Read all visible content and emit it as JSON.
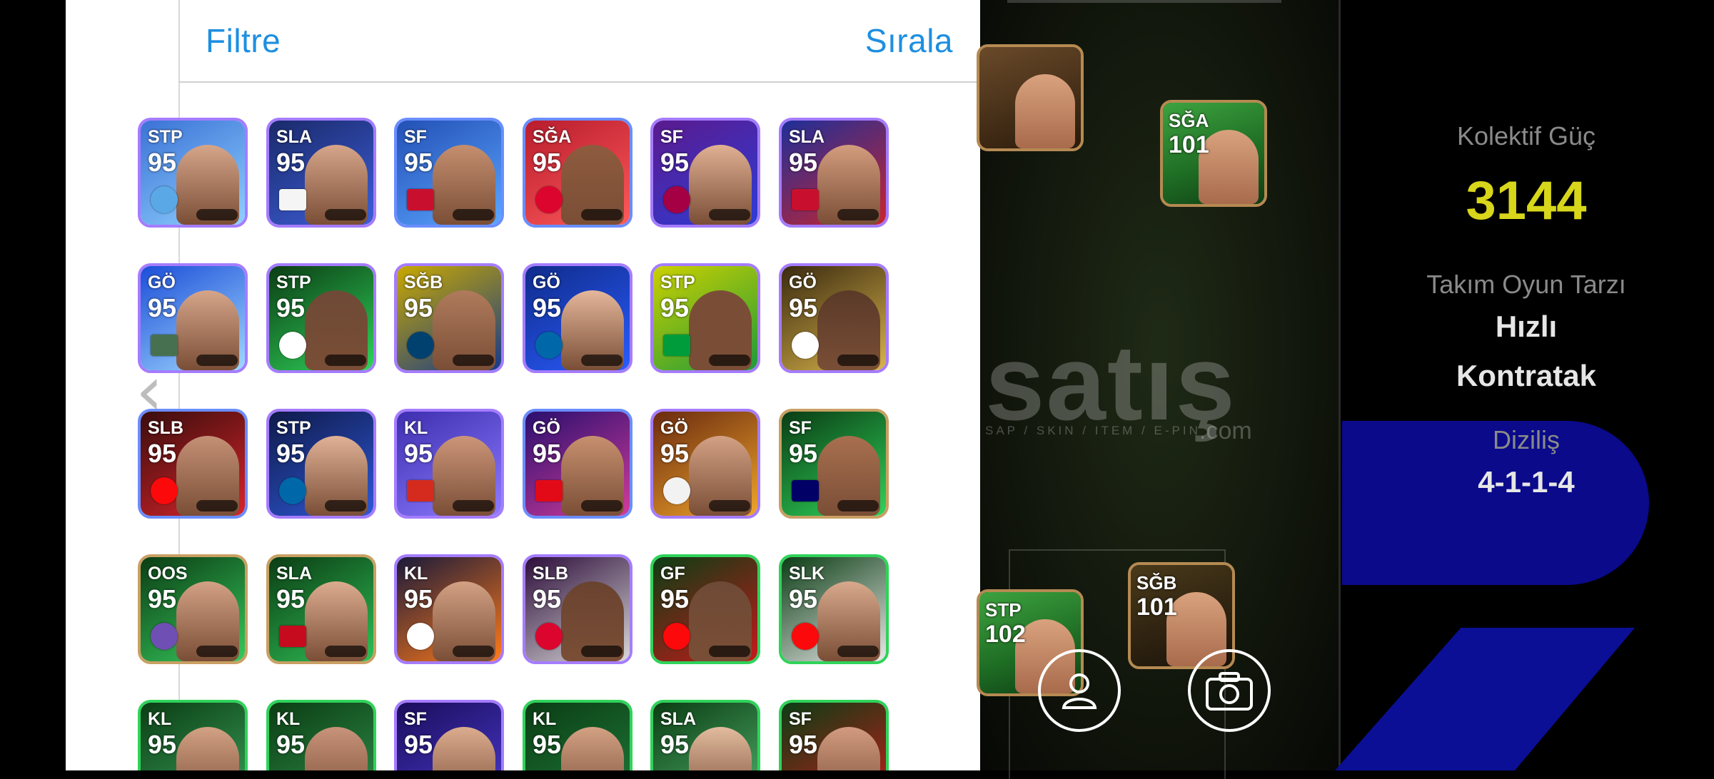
{
  "header": {
    "filter_label": "Filtre",
    "sort_label": "Sırala"
  },
  "cards": [
    {
      "pos": "STP",
      "rating": "95",
      "bg": "#3b72d6",
      "bg2": "#8fd0ff",
      "border": "b-purple",
      "badge": "round",
      "badge_color": "#5aa9e6",
      "face": "#d6a58a"
    },
    {
      "pos": "SLA",
      "rating": "95",
      "bg": "#1a2a6b",
      "bg2": "#3d5ed8",
      "border": "b-purple",
      "badge": "flag",
      "badge_color": "#f5f5f5",
      "face": "#d6a58a"
    },
    {
      "pos": "SF",
      "rating": "95",
      "bg": "#2350b5",
      "bg2": "#5aa5ff",
      "border": "b-blue",
      "badge": "flag",
      "badge_color": "#c8102e",
      "face": "#c58e6f"
    },
    {
      "pos": "SĞA",
      "rating": "95",
      "bg": "#b81c2d",
      "bg2": "#ff5a5a",
      "border": "b-blue",
      "badge": "round",
      "badge_color": "#dc052d",
      "face": "#8e5b3e"
    },
    {
      "pos": "SF",
      "rating": "95",
      "bg": "#5b1a8e",
      "bg2": "#2d3dd6",
      "border": "b-purple",
      "badge": "round",
      "badge_color": "#a50044",
      "face": "#e0b093"
    },
    {
      "pos": "SLA",
      "rating": "95",
      "bg": "#1e2f99",
      "bg2": "#c9242f",
      "border": "b-purple",
      "badge": "flag",
      "badge_color": "#c8102e",
      "face": "#d39c7e"
    },
    {
      "pos": "GÖ",
      "rating": "95",
      "bg": "#1c4ed8",
      "bg2": "#9fd8ff",
      "border": "b-purple",
      "badge": "flag",
      "badge_color": "#477050",
      "face": "#d6a58a"
    },
    {
      "pos": "STP",
      "rating": "95",
      "bg": "#0b3d14",
      "bg2": "#2fd35a",
      "border": "b-purple",
      "badge": "round",
      "badge_color": "#ffffff",
      "face": "#6e4a36"
    },
    {
      "pos": "SĞB",
      "rating": "95",
      "bg": "#c9a800",
      "bg2": "#163a8a",
      "border": "b-purple",
      "badge": "round",
      "badge_color": "#004170",
      "face": "#b07b5c"
    },
    {
      "pos": "GÖ",
      "rating": "95",
      "bg": "#0f2b8a",
      "bg2": "#2a5cff",
      "border": "b-purple",
      "badge": "round",
      "badge_color": "#0068a8",
      "face": "#e4b79b"
    },
    {
      "pos": "STP",
      "rating": "95",
      "bg": "#cbd000",
      "bg2": "#1e9a3a",
      "border": "b-purple",
      "badge": "flag",
      "badge_color": "#009c3b",
      "face": "#7a4e36"
    },
    {
      "pos": "GÖ",
      "rating": "95",
      "bg": "#3a2a10",
      "bg2": "#d9b44a",
      "border": "b-purple",
      "badge": "round",
      "badge_color": "#ffffff",
      "face": "#5a3a28"
    },
    {
      "pos": "SLB",
      "rating": "95",
      "bg": "#3a0d0d",
      "bg2": "#d8242a",
      "border": "b-blue",
      "badge": "round",
      "badge_color": "#fb090b",
      "face": "#c49075"
    },
    {
      "pos": "STP",
      "rating": "95",
      "bg": "#0e1a4a",
      "bg2": "#2f58d6",
      "border": "b-purple",
      "badge": "round",
      "badge_color": "#0068a8",
      "face": "#e0b196"
    },
    {
      "pos": "KL",
      "rating": "95",
      "bg": "#3d2fb0",
      "bg2": "#8d7bff",
      "border": "b-purple",
      "badge": "flag",
      "badge_color": "#d52b1e",
      "face": "#cc9579"
    },
    {
      "pos": "GÖ",
      "rating": "95",
      "bg": "#2a0f6e",
      "bg2": "#d13b9c",
      "border": "b-blue",
      "badge": "flag",
      "badge_color": "#e30a17",
      "face": "#c7906f"
    },
    {
      "pos": "GÖ",
      "rating": "95",
      "bg": "#6a2a0f",
      "bg2": "#f0a52a",
      "border": "b-purple",
      "badge": "round",
      "badge_color": "#f2f2f2",
      "face": "#d3a184"
    },
    {
      "pos": "SF",
      "rating": "95",
      "bg": "#0a3d14",
      "bg2": "#2fd35a",
      "border": "b-gold",
      "badge": "flag",
      "badge_color": "#010066",
      "face": "#a86f4f"
    },
    {
      "pos": "OOS",
      "rating": "95",
      "bg": "#0b3d14",
      "bg2": "#36c95c",
      "border": "b-gold",
      "badge": "round",
      "badge_color": "#6f4fb3",
      "face": "#d3a184"
    },
    {
      "pos": "SLA",
      "rating": "95",
      "bg": "#0b3d14",
      "bg2": "#2fbf55",
      "border": "b-gold",
      "badge": "flag",
      "badge_color": "#c60b1e",
      "face": "#dcac8f"
    },
    {
      "pos": "KL",
      "rating": "95",
      "bg": "#1a1a3a",
      "bg2": "#ff7a1a",
      "border": "b-purple",
      "badge": "round",
      "badge_color": "#ffffff",
      "face": "#d3a184"
    },
    {
      "pos": "SLB",
      "rating": "95",
      "bg": "#2d0d3a",
      "bg2": "#d8d8d8",
      "border": "b-purple",
      "badge": "round",
      "badge_color": "#dc052d",
      "face": "#6a4330"
    },
    {
      "pos": "GF",
      "rating": "95",
      "bg": "#0b3d14",
      "bg2": "#c41a1a",
      "border": "b-green",
      "badge": "round",
      "badge_color": "#fb090b",
      "face": "#6e4a36"
    },
    {
      "pos": "SLK",
      "rating": "95",
      "bg": "#0b3d14",
      "bg2": "#e8e8e8",
      "border": "b-green",
      "badge": "round",
      "badge_color": "#fb090b",
      "face": "#d8a98c"
    },
    {
      "pos": "KL",
      "rating": "95",
      "bg": "#0b3d14",
      "bg2": "#3aa05a",
      "border": "b-green",
      "badge": "none",
      "badge_color": "#ffffff",
      "face": "#d3a184"
    },
    {
      "pos": "KL",
      "rating": "95",
      "bg": "#0b3d14",
      "bg2": "#2f8f4a",
      "border": "b-green",
      "badge": "none",
      "badge_color": "#ffffff",
      "face": "#c8937a"
    },
    {
      "pos": "SF",
      "rating": "95",
      "bg": "#1a0d5a",
      "bg2": "#4a3ad0",
      "border": "b-purple",
      "badge": "none",
      "badge_color": "#ffffff",
      "face": "#dcac8f"
    },
    {
      "pos": "KL",
      "rating": "95",
      "bg": "#0b3d14",
      "bg2": "#1f7a3a",
      "border": "b-green",
      "badge": "none",
      "badge_color": "#ffffff",
      "face": "#d3a184"
    },
    {
      "pos": "SLA",
      "rating": "95",
      "bg": "#0b3d14",
      "bg2": "#4fb06a",
      "border": "b-green",
      "badge": "none",
      "badge_color": "#ffffff",
      "face": "#e2bb9e"
    },
    {
      "pos": "SF",
      "rating": "95",
      "bg": "#0b3d14",
      "bg2": "#c41a1a",
      "border": "b-green",
      "badge": "none",
      "badge_color": "#ffffff",
      "face": "#d29b80"
    }
  ],
  "pitch": {
    "players": [
      {
        "pos": "",
        "rating": "",
        "name": "partial-card-top"
      },
      {
        "pos": "SĞA",
        "rating": "101",
        "name": "card-sga-101"
      },
      {
        "pos": "STP",
        "rating": "102",
        "name": "card-stp-102"
      },
      {
        "pos": "SĞB",
        "rating": "101",
        "name": "card-sgb-101"
      }
    ],
    "watermark": "satış",
    "watermark_sub": "SAP / SKIN / ITEM / E-PIN",
    "watermark_com": ".com"
  },
  "info": {
    "power_label": "Kolektif Güç",
    "power_value": "3144",
    "style_label": "Takım Oyun Tarzı",
    "style_value_1": "Hızlı",
    "style_value_2": "Kontratak",
    "formation_label": "Diziliş",
    "formation_value": "4-1-1-4"
  },
  "icons": {
    "back": "chevron-left-icon",
    "profile": "profile-icon",
    "camera": "camera-icon"
  }
}
